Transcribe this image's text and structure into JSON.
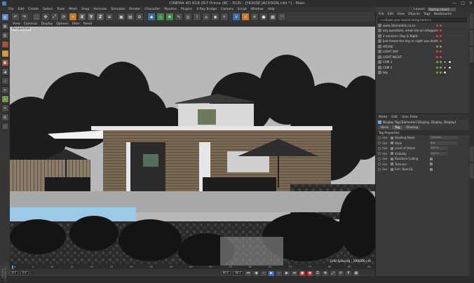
{
  "window": {
    "title": "CINEMA 4D R18.057 Prime (RC - R18) - [HOUSE JACKSON.c4d *] - Main",
    "controls": [
      "—",
      "□",
      "✕"
    ]
  },
  "menubar": {
    "items": [
      "File",
      "Edit",
      "Create",
      "Select",
      "Tools",
      "Mesh",
      "Snap",
      "Animate",
      "Simulate",
      "Render",
      "Character",
      "Pipeline",
      "Plugins",
      "V-Ray Bridge",
      "Camera",
      "Script",
      "Window",
      "Help"
    ],
    "layout_label": "Layout:",
    "layout_value": "Startup (User)"
  },
  "toolbar": {
    "axis_labels": [
      "X",
      "Y",
      "Z"
    ]
  },
  "viewport": {
    "menu": [
      "View",
      "Cameras",
      "Display",
      "Options",
      "Filter",
      "Panel"
    ],
    "view_label": "Perspective",
    "grid_spacing": "Grid Spacing : 100000 cm"
  },
  "timeline": {
    "ticks": [
      "0",
      "5",
      "10",
      "15",
      "20",
      "25",
      "30",
      "35",
      "40",
      "45",
      "50",
      "55",
      "60",
      "65",
      "70",
      "75",
      "80",
      "85",
      "90"
    ],
    "current_frame": "0 F",
    "start_frame": "0 F",
    "end_frame": "90 F",
    "end_frame2": "90 F",
    "logo": "MAXON CINEMA 4D"
  },
  "object_manager": {
    "menu": [
      "File",
      "Edit",
      "View",
      "Objects",
      "Tags",
      "Bookmarks"
    ],
    "search_placeholder": "<<Enter your search string here>>",
    "objects": [
      {
        "name": "www.3dsmodels.co.za",
        "flag": "red"
      },
      {
        "name": "any questions, email me on info@jose...",
        "flag": "red"
      },
      {
        "name": "2 versions: Day & Night",
        "flag": "red"
      },
      {
        "name": "Just freeze the day or night you dont w...",
        "flag": "red"
      },
      {
        "name": "HOUSE",
        "flag": "green"
      },
      {
        "name": "LIGHT DAY",
        "flag": "red"
      },
      {
        "name": "LIGHT NIGHT",
        "flag": "red"
      },
      {
        "name": "CAM 1",
        "flag": "green",
        "tags": [
          "o",
          "w"
        ]
      },
      {
        "name": "CAM 2",
        "flag": "green",
        "tags": [
          "o",
          "w"
        ]
      },
      {
        "name": "Sky",
        "flag": "green",
        "tags": [
          "w"
        ]
      }
    ]
  },
  "attribute_manager": {
    "menu": [
      "Mode",
      "Edit",
      "User Data"
    ],
    "title": "Display Tag [Elements] (Display, Display, Display)",
    "tabs": [
      {
        "label": "Basic",
        "active": false
      },
      {
        "label": "Tag",
        "active": true
      },
      {
        "label": "Shading",
        "active": false
      }
    ],
    "section": "Tag Properties",
    "rows": [
      {
        "use": "Use",
        "label": "Shading Mode",
        "value": "Gouraud"
      },
      {
        "use": "Use",
        "label": "Style",
        "value": "Box"
      },
      {
        "use": "Use",
        "label": "Level of Detail",
        "value": "100 %"
      },
      {
        "use": "Use",
        "label": "Visibility",
        "value": "100 %"
      },
      {
        "use": "Use",
        "label": "Backface Culling",
        "value": ""
      },
      {
        "use": "Use",
        "label": "Textures",
        "value": ""
      },
      {
        "use": "Use",
        "label": "Enh. OpenGL",
        "value": ""
      }
    ]
  },
  "colors": {
    "accent": "#2f75c3",
    "panel_bg": "#3a3a3a",
    "viewport_bg": "#b4b4b4"
  }
}
